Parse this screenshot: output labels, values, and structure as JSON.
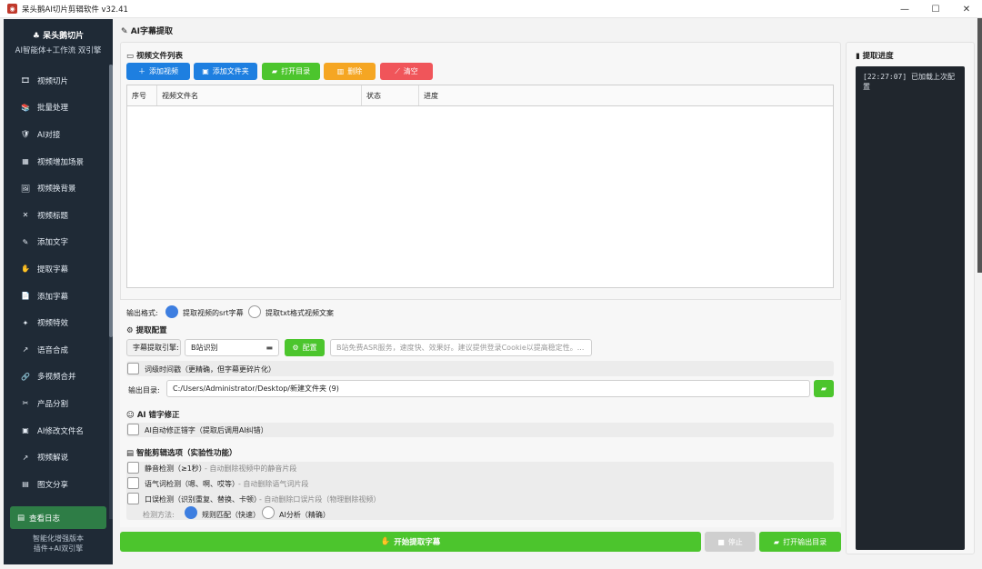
{
  "window": {
    "title": "呆头鹅AI切片剪辑软件 v32.41",
    "app_icon": "app-logo-icon"
  },
  "window_controls": {
    "minimize": "—",
    "maximize": "☐",
    "close": "✕"
  },
  "sidebar": {
    "brand_name": "呆头鹅切片",
    "brand_sub": "AI智能体+工作流 双引擎",
    "items": [
      {
        "label": "视频切片",
        "icon": "film-icon",
        "glyph": "🎞"
      },
      {
        "label": "批量处理",
        "icon": "stack-icon",
        "glyph": "📚"
      },
      {
        "label": "AI对接",
        "icon": "plug-icon",
        "glyph": "🛡"
      },
      {
        "label": "视频增加场景",
        "icon": "scene-icon",
        "glyph": "▦"
      },
      {
        "label": "视频换背景",
        "icon": "image-icon",
        "glyph": "🖼"
      },
      {
        "label": "视频标题",
        "icon": "title-icon",
        "glyph": "✕"
      },
      {
        "label": "添加文字",
        "icon": "pen-icon",
        "glyph": "✎"
      },
      {
        "label": "提取字幕",
        "icon": "extract-icon",
        "glyph": "✋"
      },
      {
        "label": "添加字幕",
        "icon": "doc-icon",
        "glyph": "📄"
      },
      {
        "label": "视频特效",
        "icon": "sparkle-icon",
        "glyph": "✦"
      },
      {
        "label": "语音合成",
        "icon": "mic-icon",
        "glyph": "↗"
      },
      {
        "label": "多视频合并",
        "icon": "link-icon",
        "glyph": "🔗"
      },
      {
        "label": "产品分割",
        "icon": "scissors-icon",
        "glyph": "✂"
      },
      {
        "label": "AI修改文件名",
        "icon": "rename-icon",
        "glyph": "▣"
      },
      {
        "label": "视频解说",
        "icon": "narrate-icon",
        "glyph": "↗"
      },
      {
        "label": "图文分享",
        "icon": "share-icon",
        "glyph": "▤"
      }
    ],
    "log_button": "查看日志",
    "footer_line1": "智能化增强版本",
    "footer_line2": "插件+AI双引擎"
  },
  "page": {
    "title": "AI字幕提取",
    "file_list_title": "视频文件列表",
    "buttons": {
      "add_video": "添加视频",
      "add_folder": "添加文件夹",
      "open_dir": "打开目录",
      "delete": "删除",
      "clear": "清空"
    },
    "table_headers": [
      "序号",
      "视频文件名",
      "状态",
      "进度"
    ]
  },
  "output_format": {
    "label": "输出格式:",
    "option_srt": "提取视频的srt字幕",
    "option_txt": "提取txt格式视频文案",
    "selected": "srt"
  },
  "extract_config": {
    "title": "提取配置",
    "engine_label": "字幕提取引擎:",
    "engine_value": "B站识别",
    "config_button": "配置",
    "engine_hint": "B站免费ASR服务，速度快、效果好。建议提供登录Cookie以提高稳定性。...",
    "word_timestamp": "词级时间戳（更精确，但字幕更碎片化）",
    "output_dir_label": "输出目录:",
    "output_dir_value": "C:/Users/Administrator/Desktop/新建文件夹 (9)"
  },
  "ai_correction": {
    "title": "AI 错字修正",
    "option": "AI自动修正错字（提取后调用AI纠错）"
  },
  "smart_edit": {
    "title": "智能剪辑选项（实验性功能）",
    "silence": "静音检测（≥1秒）",
    "silence_hint": "- 自动删除视频中的静音片段",
    "filler": "语气词检测（嗯、啊、哎等）",
    "filler_hint": "- 自动删除语气词片段",
    "stutter": "口误检测（识别重复、替换、卡顿）",
    "stutter_hint": "- 自动删除口误片段（物理删除视频）",
    "method_label": "检测方法:",
    "method_rule": "规则匹配（快速）",
    "method_ai": "AI分析（精确）",
    "method_selected": "rule"
  },
  "actions": {
    "start": "开始提取字幕",
    "stop": "停止",
    "open_output": "打开输出目录"
  },
  "progress": {
    "title": "提取进度",
    "log_line": "[22:27:07] 已加载上次配置"
  },
  "colors": {
    "sidebar_bg": "#1f2a36",
    "blue": "#1e7fe0",
    "green": "#4cc52d",
    "orange": "#f5a623",
    "red": "#f0555a",
    "radio_on": "#3d7ee0"
  }
}
